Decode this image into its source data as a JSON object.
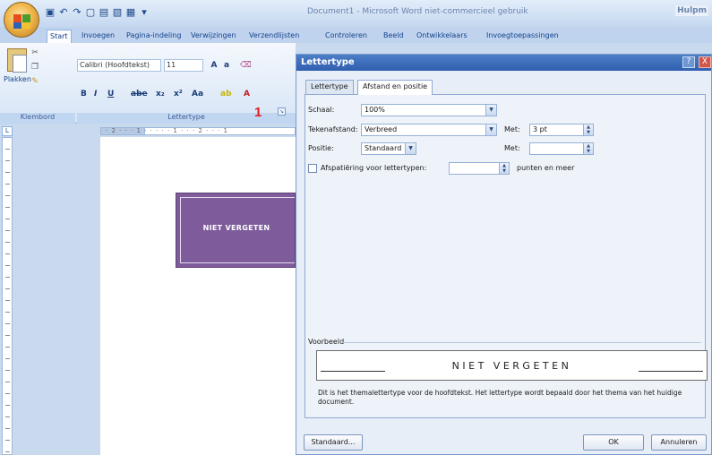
{
  "window": {
    "title": "Document1 - Microsoft Word niet-commercieel gebruik",
    "help": "Hulpm"
  },
  "ribbon": {
    "tabs": [
      "Start",
      "Invoegen",
      "Pagina-indeling",
      "Verwijzingen",
      "Verzendlijsten",
      "Controleren",
      "Beeld",
      "Ontwikkelaars",
      "Invoegtoepassingen"
    ],
    "paste_label": "Plakken",
    "font_name": "Calibri (Hoofdtekst)",
    "font_size": "11",
    "groups": {
      "clipboard": "Klembord",
      "font": "Lettertype"
    },
    "annotation_number": "1"
  },
  "ruler": {
    "marks": "· 2 · · · 1 · · · · · 1 · · · 2 · · · 1"
  },
  "document": {
    "textbox_text": "NIET VERGETEN"
  },
  "dialog": {
    "title": "Lettertype",
    "help_glyph": "?",
    "close_glyph": "X",
    "tabs": [
      "Lettertype",
      "Afstand en positie"
    ],
    "active_tab": 1,
    "fields": {
      "scale_label": "Schaal:",
      "scale_value": "100%",
      "spacing_label": "Tekenafstand:",
      "spacing_value": "Verbreed",
      "spacing_by_label": "Met:",
      "spacing_by_value": "3 pt",
      "position_label": "Positie:",
      "position_value": "Standaard",
      "position_by_label": "Met:",
      "position_by_value": "",
      "kerning_label": "Afspatiëring voor lettertypen:",
      "kerning_value": "",
      "kerning_suffix": "punten en meer",
      "kerning_checked": false
    },
    "preview": {
      "label": "Voorbeeld",
      "text": "NIET VERGETEN",
      "description": "Dit is het themalettertype voor de hoofdtekst. Het lettertype wordt bepaald door het thema van het huidige document."
    },
    "buttons": {
      "default": "Standaard...",
      "ok": "OK",
      "cancel": "Annuleren"
    }
  }
}
